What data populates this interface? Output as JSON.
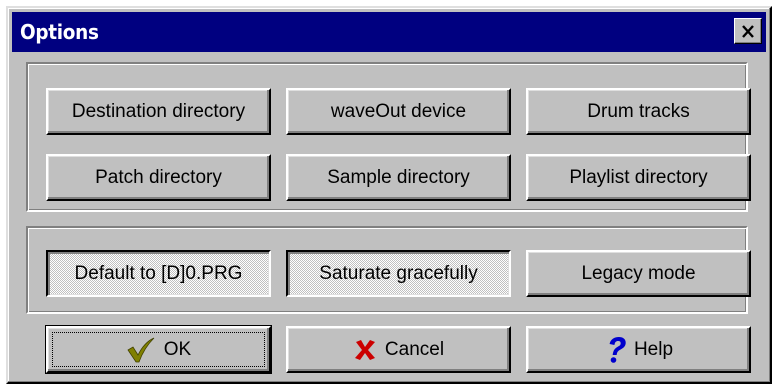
{
  "window": {
    "title": "Options",
    "close_icon": "close-icon"
  },
  "directories": {
    "destination_label": "Destination directory",
    "waveout_label": "waveOut device",
    "drum_tracks_label": "Drum tracks",
    "patch_label": "Patch directory",
    "sample_label": "Sample directory",
    "playlist_label": "Playlist directory"
  },
  "toggles": {
    "default_prg_label": "Default to [D]0.PRG",
    "default_prg_checked": true,
    "saturate_label": "Saturate gracefully",
    "saturate_checked": true,
    "legacy_label": "Legacy mode",
    "legacy_checked": false
  },
  "actions": {
    "ok_label": "OK",
    "ok_icon": "checkmark-icon",
    "cancel_label": "Cancel",
    "cancel_icon": "x-icon",
    "help_label": "Help",
    "help_icon": "question-mark-icon"
  },
  "colors": {
    "titlebar": "#000080",
    "face": "#c0c0c0",
    "checkmark": "#808000",
    "cancel_x": "#cc0000",
    "help": "#0000cc"
  }
}
